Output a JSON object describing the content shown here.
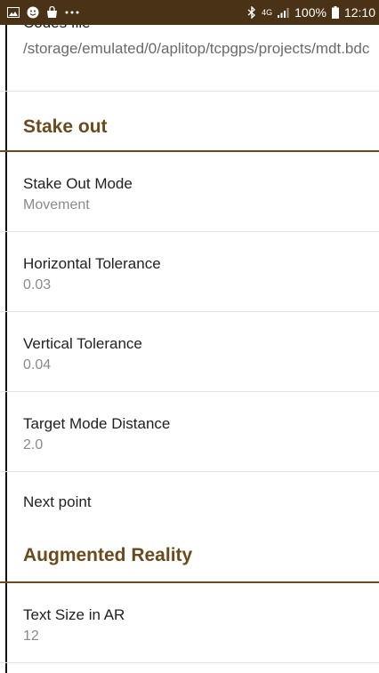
{
  "status_bar": {
    "network": "4G",
    "battery": "100%",
    "time": "12:10",
    "icons": [
      "gallery-icon",
      "face-icon",
      "bag-icon",
      "more-dots-icon",
      "bluetooth-icon",
      "signal-icon",
      "battery-icon"
    ]
  },
  "codes_file": {
    "title": "Codes file",
    "path": "/storage/emulated/0/aplitop/tcpgps/projects/mdt.bdc"
  },
  "stake_out": {
    "category": "Stake out",
    "items": [
      {
        "title": "Stake Out Mode",
        "value": "Movement"
      },
      {
        "title": "Horizontal Tolerance",
        "value": "0.03"
      },
      {
        "title": "Vertical Tolerance",
        "value": "0.04"
      },
      {
        "title": "Target Mode Distance",
        "value": "2.0"
      }
    ],
    "next_point": "Next point"
  },
  "augmented_reality": {
    "category": "Augmented Reality",
    "items": [
      {
        "title": "Text Size in AR",
        "value": "12"
      }
    ]
  },
  "colors": {
    "status_bar": "#4a3217",
    "accent": "#6b4a1d"
  }
}
